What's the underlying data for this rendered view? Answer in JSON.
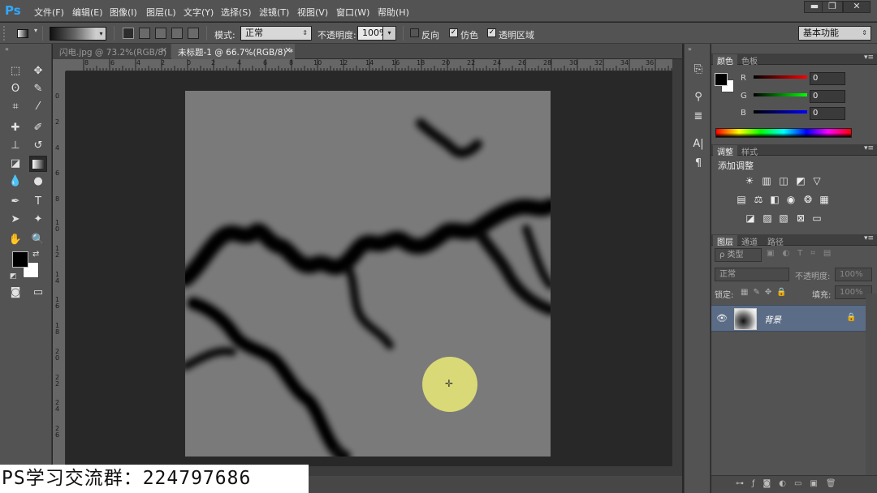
{
  "menubar": {
    "logo": "Ps",
    "items": [
      "文件(F)",
      "编辑(E)",
      "图像(I)",
      "图层(L)",
      "文字(Y)",
      "选择(S)",
      "滤镜(T)",
      "视图(V)",
      "窗口(W)",
      "帮助(H)"
    ],
    "window_controls": [
      "▬",
      "❐",
      "✕"
    ]
  },
  "options_bar": {
    "mode_label": "模式:",
    "mode_value": "正常",
    "opacity_label": "不透明度:",
    "opacity_value": "100%",
    "reverse_label": "反向",
    "dither_label": "仿色",
    "transparency_label": "透明区域",
    "workspace_value": "基本功能"
  },
  "document_tabs": [
    {
      "label": "闪电.jpg @ 73.2%(RGB/8)",
      "close": "×"
    },
    {
      "label": "未标题-1 @ 66.7%(RGB/8) *",
      "close": "×"
    }
  ],
  "rulers": {
    "horizontal": [
      "8",
      "6",
      "4",
      "2",
      "0",
      "2",
      "4",
      "6",
      "8",
      "10",
      "12",
      "14",
      "16",
      "18",
      "20",
      "22",
      "24",
      "26",
      "28",
      "30",
      "32",
      "34",
      "36"
    ],
    "vertical": [
      "0",
      "2",
      "4",
      "6",
      "8",
      "1\n0",
      "1\n2",
      "1\n4",
      "1\n6",
      "1\n8",
      "2\n0",
      "2\n2",
      "2\n4",
      "2\n6"
    ]
  },
  "color_panel": {
    "tabs": [
      "颜色",
      "色板"
    ],
    "channels": [
      {
        "label": "R",
        "value": "0"
      },
      {
        "label": "G",
        "value": "0"
      },
      {
        "label": "B",
        "value": "0"
      }
    ]
  },
  "adjust_panel": {
    "tabs": [
      "调整",
      "样式"
    ],
    "title": "添加调整"
  },
  "layers_panel": {
    "tabs": [
      "图层",
      "通道",
      "路径"
    ],
    "filter_label": "ρ 类型",
    "blend_mode": "正常",
    "opacity_label": "不透明度:",
    "opacity_value": "100%",
    "lock_label": "锁定:",
    "fill_label": "填充:",
    "fill_value": "100%",
    "layers": [
      {
        "name": "背景",
        "visible": true,
        "locked": true
      }
    ],
    "footer_icons": [
      "link-icon",
      "fx-icon",
      "mask-icon",
      "adjustment-icon",
      "folder-icon",
      "new-layer-icon",
      "trash-icon"
    ]
  },
  "watermark": "PS学习交流群：224797686",
  "colors": {
    "foreground": "#000000",
    "background": "#ffffff",
    "accent": "#31a8ff",
    "highlight_spot": "#eeee78"
  }
}
